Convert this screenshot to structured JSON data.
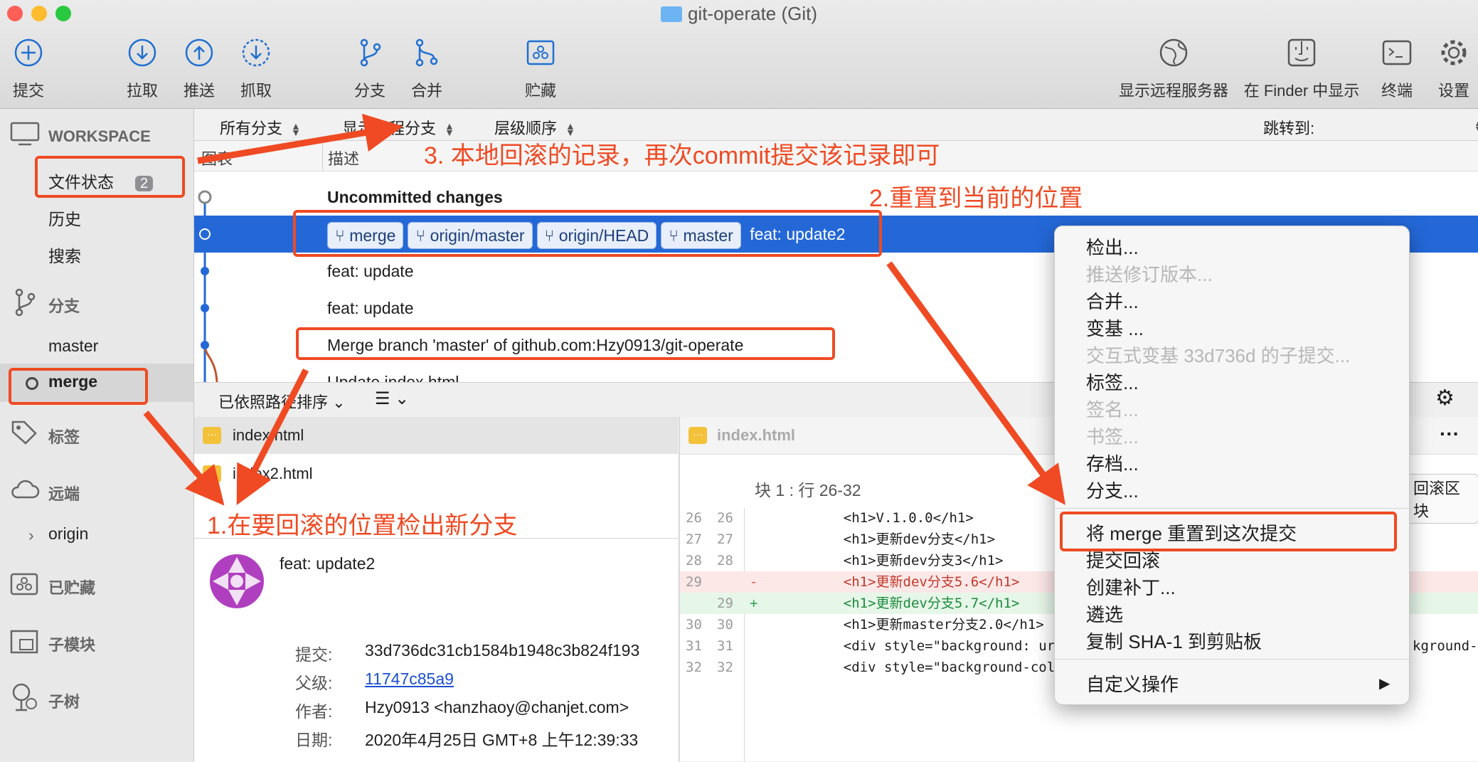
{
  "window": {
    "title": "git-operate (Git)"
  },
  "toolbar": {
    "commit": "提交",
    "pull": "拉取",
    "push": "推送",
    "fetch": "抓取",
    "branch": "分支",
    "merge": "合并",
    "stash": "贮藏",
    "remote": "显示远程服务器",
    "finder": "在 Finder 中显示",
    "terminal": "终端",
    "settings": "设置"
  },
  "sidebar": {
    "workspace": "WORKSPACE",
    "file_status": "文件状态",
    "file_status_count": "2",
    "history": "历史",
    "search": "搜索",
    "branches": "分支",
    "branch_master": "master",
    "branch_merge": "merge",
    "tags": "标签",
    "remotes": "远端",
    "remote_origin": "origin",
    "stashes": "已贮藏",
    "submodules": "子模块",
    "subtrees": "子树"
  },
  "filters": {
    "all_branches": "所有分支",
    "show_remote": "显示远程分支",
    "order": "层级顺序",
    "jump_to": "跳转到:"
  },
  "columns": {
    "graph": "图表",
    "description": "描述"
  },
  "commits": [
    {
      "text": "Uncommitted changes"
    },
    {
      "tags": [
        "merge",
        "origin/master",
        "origin/HEAD",
        "master"
      ],
      "text": "feat: update2"
    },
    {
      "text": "feat: update"
    },
    {
      "text": "feat: update"
    },
    {
      "text": "Merge branch 'master' of github.com:Hzy0913/git-operate"
    },
    {
      "text": "Update index.html"
    }
  ],
  "file_toolbar": {
    "sort": "已依照路径排序"
  },
  "files": [
    {
      "name": "index.html"
    },
    {
      "name": "index2.html"
    }
  ],
  "detail": {
    "message": "feat: update2",
    "commit_label": "提交:",
    "commit_value": "33d736dc31cb1584b1948c3b824f193",
    "parent_label": "父级:",
    "parent_value": "11747c85a9",
    "author_label": "作者:",
    "author_value": "Hzy0913 <hanzhaoy@chanjet.com>",
    "date_label": "日期:",
    "date_value": "2020年4月25日 GMT+8 上午12:39:33"
  },
  "diff": {
    "file": "index.html",
    "hunk": "块 1 :  行 26-32",
    "rollback_hunk": "回滚区块",
    "lines": [
      {
        "old": "26",
        "new": "26",
        "sign": "",
        "code": "    <h1>V.1.0.0</h1>",
        "type": "ctx"
      },
      {
        "old": "27",
        "new": "27",
        "sign": "",
        "code": "    <h1>更新dev分支</h1>",
        "type": "ctx"
      },
      {
        "old": "28",
        "new": "28",
        "sign": "",
        "code": "    <h1>更新dev分支3</h1>",
        "type": "ctx"
      },
      {
        "old": "29",
        "new": "",
        "sign": "-",
        "code": "    <h1>更新dev分支5.6</h1>",
        "type": "del"
      },
      {
        "old": "",
        "new": "29",
        "sign": "+",
        "code": "    <h1>更新dev分支5.7</h1>",
        "type": "add"
      },
      {
        "old": "30",
        "new": "30",
        "sign": "",
        "code": "    <h1>更新master分支2.0</h1>",
        "type": "ctx"
      },
      {
        "old": "31",
        "new": "31",
        "sign": "",
        "code": "    <div style=\"background: url(",
        "type": "ctx"
      },
      {
        "old": "32",
        "new": "32",
        "sign": "",
        "code": "    <div style=\"background-color:",
        "type": "ctx"
      }
    ],
    "overflow_text": "kground-"
  },
  "menu": {
    "items": [
      {
        "label": "检出...",
        "enabled": true
      },
      {
        "label": "推送修订版本...",
        "enabled": false
      },
      {
        "label": "合并...",
        "enabled": true
      },
      {
        "label": "变基 ...",
        "enabled": true
      },
      {
        "label": "交互式变基 33d736d 的子提交...",
        "enabled": false
      },
      {
        "label": "标签...",
        "enabled": true
      },
      {
        "label": "签名...",
        "enabled": false
      },
      {
        "label": "书签...",
        "enabled": false
      },
      {
        "label": "存档...",
        "enabled": true
      },
      {
        "label": "分支...",
        "enabled": true
      },
      {
        "label": "将 merge 重置到这次提交",
        "enabled": true
      },
      {
        "label": "提交回滚",
        "enabled": true
      },
      {
        "label": "创建补丁...",
        "enabled": true
      },
      {
        "label": "遴选",
        "enabled": true
      },
      {
        "label": "复制 SHA-1 到剪贴板",
        "enabled": true
      },
      {
        "label": "自定义操作",
        "enabled": true
      }
    ],
    "submenu_arrow": "▶"
  },
  "annotations": {
    "step1": "1.在要回滚的位置检出新分支",
    "step2": "2.重置到当前的位置",
    "step3": "3. 本地回滚的记录，再次commit提交该记录即可"
  },
  "colors": {
    "accent": "#2468d8",
    "annotation": "#ef4a23"
  }
}
